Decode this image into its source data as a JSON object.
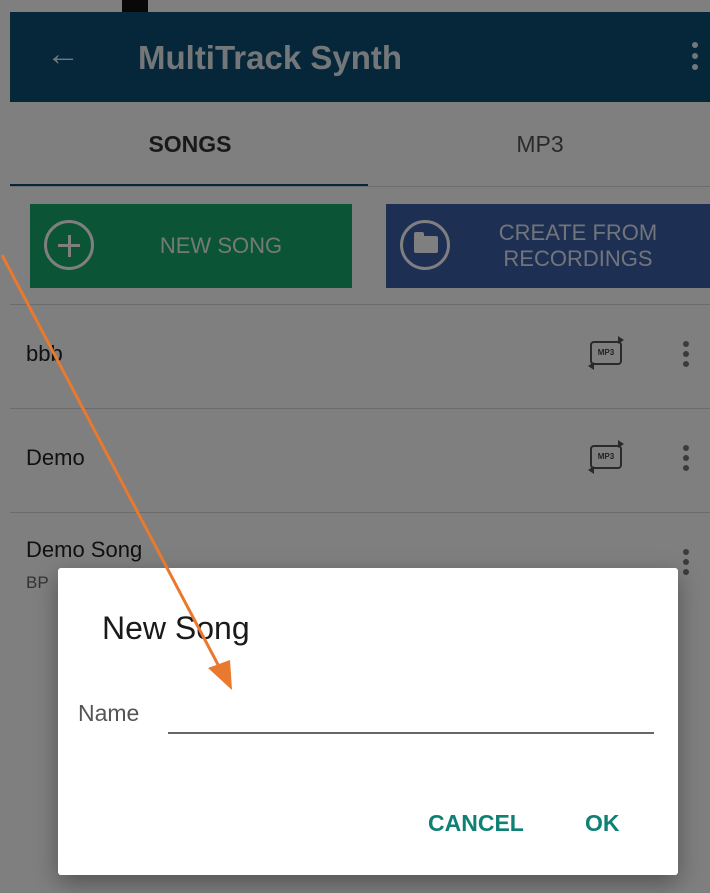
{
  "app": {
    "back_icon": "arrow-left-icon",
    "title": "MultiTrack Synth",
    "overflow_icon": "vertical-ellipsis-icon",
    "brand_color": "#0d4f73"
  },
  "tabs": [
    {
      "label": "SONGS",
      "selected": true
    },
    {
      "label": "MP3",
      "selected": false
    }
  ],
  "actions": {
    "new_song": {
      "label": "NEW SONG",
      "icon": "plus-circle-icon",
      "color": "#17a86b"
    },
    "create_from": {
      "label": "CREATE FROM\nRECORDINGS",
      "icon": "folder-circle-icon",
      "color": "#3d5fa8"
    }
  },
  "songs": [
    {
      "name": "bbb",
      "sub": "",
      "badge": "MP3"
    },
    {
      "name": "Demo",
      "sub": "",
      "badge": "MP3"
    },
    {
      "name": "Demo Song",
      "sub": "BP"
    }
  ],
  "dialog": {
    "title": "New Song",
    "name_label": "Name",
    "name_value": "",
    "cancel_label": "CANCEL",
    "ok_label": "OK",
    "accent_color": "#0e8074"
  },
  "annotation": {
    "arrow_color": "#e8792e"
  }
}
